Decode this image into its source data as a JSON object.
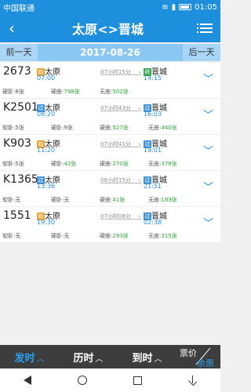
{
  "status": {
    "carrier": "中国联通",
    "time": "01:05"
  },
  "header": {
    "back": "‹",
    "title": "太原<>晋城"
  },
  "datebar": {
    "prev": "前一天",
    "date": "2017-08-26",
    "next": "后一天"
  },
  "trains": [
    {
      "no": "2673",
      "from": "太原",
      "from_badge": "始",
      "from_time": "07:00",
      "duration": "07小时15分",
      "to": "晋城",
      "to_badge": "终",
      "to_time": "14:15",
      "seats": [
        {
          "label": "硬卧:",
          "value": "8张",
          "green": false
        },
        {
          "label": "硬座:",
          "value": "798张",
          "green": true
        },
        {
          "label": "无座:",
          "value": "502张",
          "green": true
        }
      ]
    },
    {
      "no": "K2501",
      "from": "太原",
      "from_badge": "过",
      "from_time": "08:20",
      "duration": "07小时43分",
      "to": "晋城",
      "to_badge": "过",
      "to_time": "16:03",
      "seats": [
        {
          "label": "软卧:",
          "value": "5张",
          "green": false
        },
        {
          "label": "硬卧:",
          "value": "9张",
          "green": false
        },
        {
          "label": "硬座:",
          "value": "527张",
          "green": true
        },
        {
          "label": "无座:",
          "value": "440张",
          "green": true
        }
      ]
    },
    {
      "no": "K903",
      "from": "太原",
      "from_badge": "始",
      "from_time": "11:20",
      "duration": "07小时41分",
      "to": "晋城",
      "to_badge": "过",
      "to_time": "19:01",
      "seats": [
        {
          "label": "软卧:",
          "value": "5张",
          "green": false
        },
        {
          "label": "硬卧:",
          "value": "42张",
          "green": true
        },
        {
          "label": "硬座:",
          "value": "270张",
          "green": true
        },
        {
          "label": "无座:",
          "value": "378张",
          "green": true
        }
      ]
    },
    {
      "no": "K1365",
      "from": "太原",
      "from_badge": "过",
      "from_time": "13:36",
      "duration": "08小时15分",
      "to": "晋城",
      "to_badge": "过",
      "to_time": "21:51",
      "seats": [
        {
          "label": "软卧:",
          "value": "无",
          "green": false
        },
        {
          "label": "硬卧:",
          "value": "无",
          "green": false
        },
        {
          "label": "硬座:",
          "value": "41张",
          "green": true
        },
        {
          "label": "无座:",
          "value": "183张",
          "green": true
        }
      ]
    },
    {
      "no": "1551",
      "from": "太原",
      "from_badge": "始",
      "from_time": "19:30",
      "duration": "07小时08分",
      "to": "晋城",
      "to_badge": "过",
      "to_time": "02:38",
      "seats": [
        {
          "label": "软卧:",
          "value": "无",
          "green": false
        },
        {
          "label": "硬卧:",
          "value": "无",
          "green": false
        },
        {
          "label": "硬座:",
          "value": "293张",
          "green": true
        },
        {
          "label": "无座:",
          "value": "315张",
          "green": true
        }
      ]
    }
  ],
  "bottom": {
    "depart": "发时",
    "duration": "历时",
    "arrive": "到时",
    "price": "票价",
    "remain": "余票"
  }
}
